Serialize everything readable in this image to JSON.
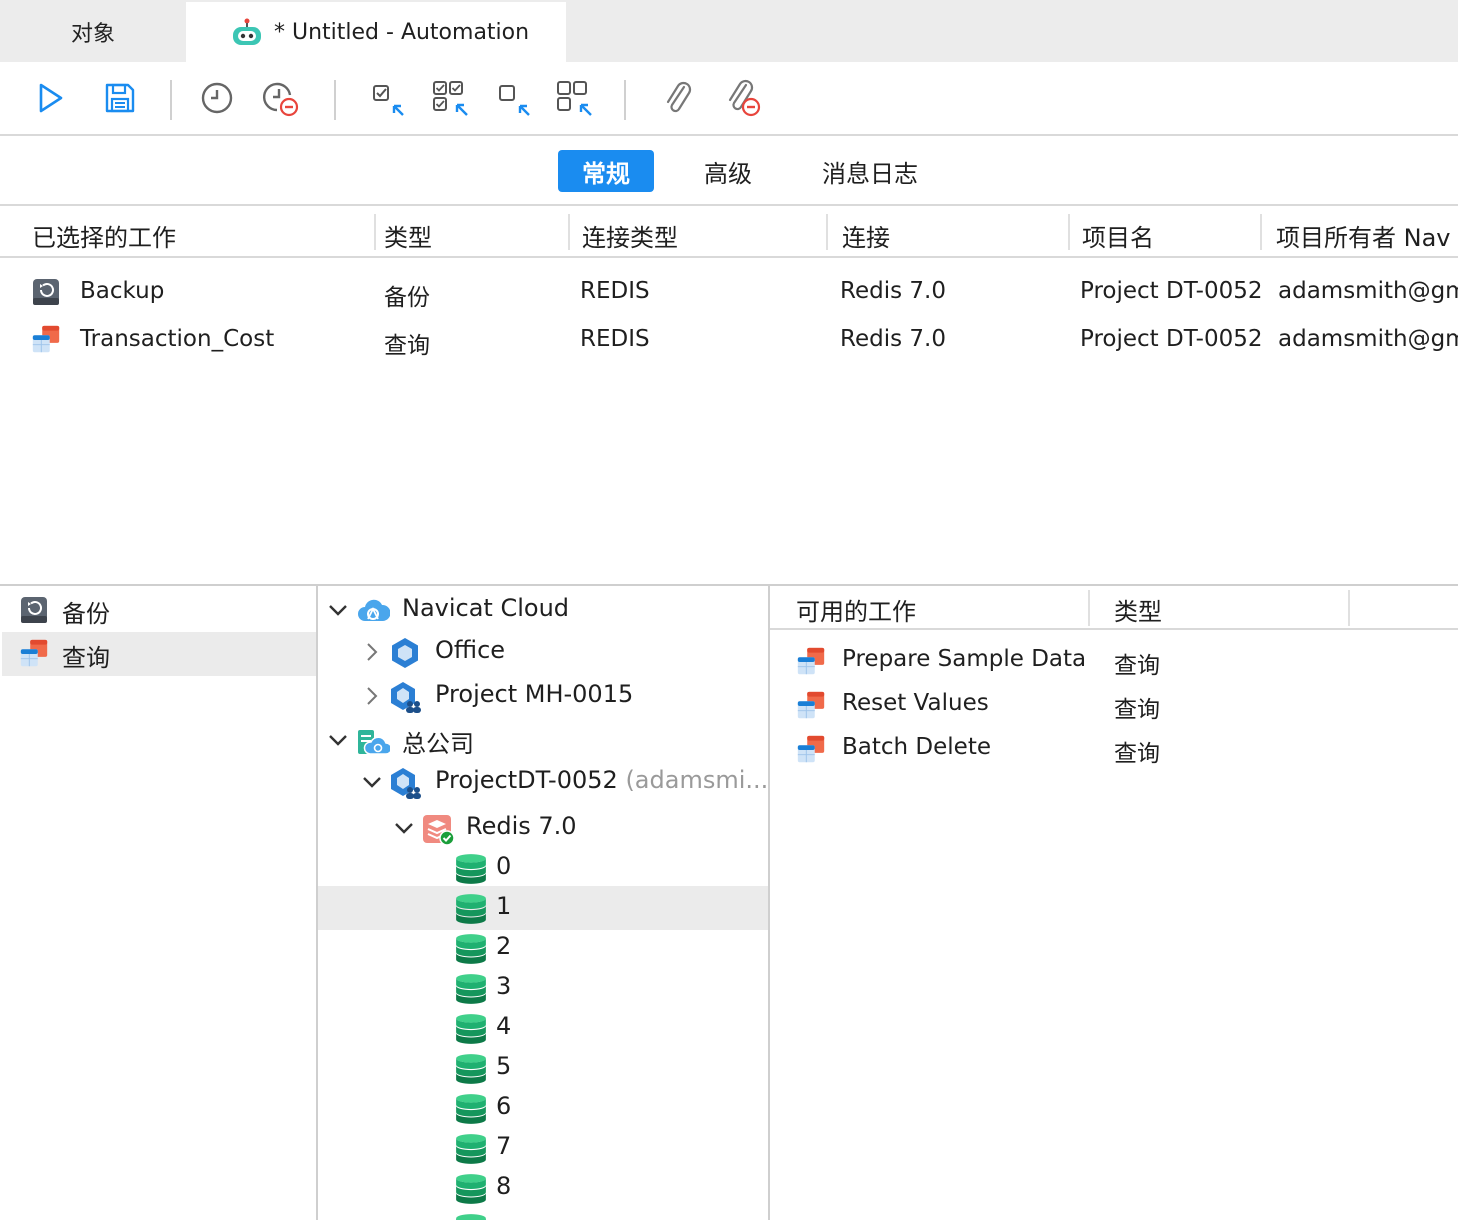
{
  "tabs": {
    "objects": "对象",
    "automation": "* Untitled - Automation"
  },
  "toolbar": {
    "buttons": [
      {
        "icon": "play-icon"
      },
      {
        "icon": "save-icon"
      },
      {
        "icon": "schedule-icon"
      },
      {
        "icon": "remove-schedule-icon"
      },
      {
        "icon": "select-job-icon"
      },
      {
        "icon": "select-all-jobs-icon"
      },
      {
        "icon": "deselect-job-icon"
      },
      {
        "icon": "deselect-all-jobs-icon"
      },
      {
        "icon": "attach-icon"
      },
      {
        "icon": "remove-attachment-icon"
      }
    ]
  },
  "segments": {
    "general": "常规",
    "advanced": "高级",
    "message_log": "消息日志"
  },
  "jobs_table": {
    "headers": [
      "已选择的工作",
      "类型",
      "连接类型",
      "连接",
      "项目名",
      "项目所有者 Nav"
    ],
    "rows": [
      {
        "name": "Backup",
        "type": "备份",
        "conn_type": "REDIS",
        "conn": "Redis 7.0",
        "project": "Project DT-0052",
        "owner": "adamsmith@gm",
        "icon": "backup-icon"
      },
      {
        "name": "Transaction_Cost",
        "type": "查询",
        "conn_type": "REDIS",
        "conn": "Redis 7.0",
        "project": "Project DT-0052",
        "owner": "adamsmith@gm",
        "icon": "query-icon"
      }
    ]
  },
  "categories": [
    {
      "label": "备份",
      "icon": "backup-icon"
    },
    {
      "label": "查询",
      "icon": "query-icon"
    }
  ],
  "tree": {
    "navicat_cloud": "Navicat Cloud",
    "office": "Office",
    "project_mh": "Project MH-0015",
    "head_office": "总公司",
    "project_dt": "ProjectDT-0052",
    "project_dt_owner": "(adamsmi...",
    "redis": "Redis 7.0",
    "dbs": [
      "0",
      "1",
      "2",
      "3",
      "4",
      "5",
      "6",
      "7",
      "8"
    ]
  },
  "available": {
    "headers": [
      "可用的工作",
      "类型"
    ],
    "rows": [
      {
        "name": "Prepare Sample Data",
        "type": "查询"
      },
      {
        "name": "Reset Values",
        "type": "查询"
      },
      {
        "name": "Batch Delete",
        "type": "查询"
      }
    ]
  },
  "colors": {
    "accent": "#1a8cf0",
    "danger": "#e8453c",
    "db_green": "#1a9e5a"
  }
}
